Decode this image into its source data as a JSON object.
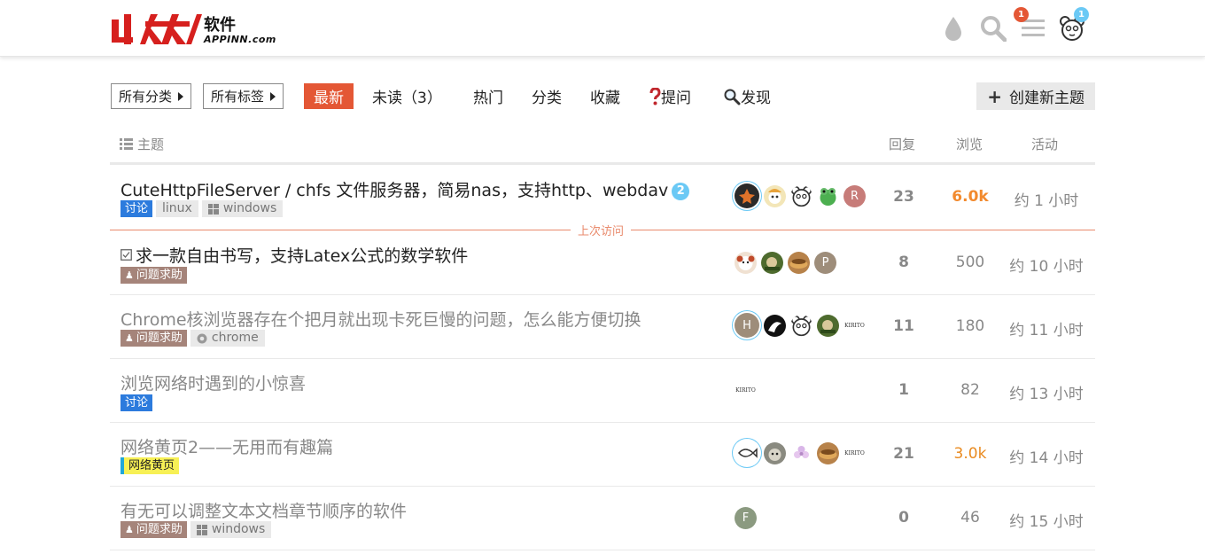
{
  "header": {
    "logo_cn": "软件",
    "logo_en": "APPINN.com",
    "icons": [
      "drop-icon",
      "search-icon",
      "hamburger-icon",
      "user-avatar-icon"
    ],
    "menu_badge": "1",
    "user_badge": "1",
    "colors": {
      "accent": "#e45735",
      "badge_blue": "#6bc9f5"
    }
  },
  "nav": {
    "categories_dropdown": "所有分类",
    "tags_dropdown": "所有标签",
    "items": [
      "最新",
      "未读（3）",
      "热门",
      "分类",
      "收藏",
      "提问",
      "发现"
    ],
    "active": "最新",
    "create_button": "创建新主题"
  },
  "table": {
    "headers": {
      "topic": "主题",
      "replies": "回复",
      "views": "浏览",
      "activity": "活动"
    },
    "last_visit_label": "上次访问",
    "topics": [
      {
        "title": "CuteHttpFileServer / chfs 文件服务器，简易nas，支持http、webdav",
        "unread": "2",
        "category": "讨论",
        "tags": [
          "linux",
          "windows"
        ],
        "replies": "23",
        "views": "6.0k",
        "activity": "约 1 小时"
      },
      {
        "title": "求一款自由书写，支持Latex公式的数学软件",
        "category": "问题求助",
        "tags": [],
        "replies": "8",
        "views": "500",
        "activity": "约 10 小时"
      },
      {
        "title": "Chrome核浏览器存在个把月就出现卡死巨慢的问题，怎么能方便切换",
        "category": "问题求助",
        "tags": [
          "chrome"
        ],
        "replies": "11",
        "views": "180",
        "activity": "约 11 小时"
      },
      {
        "title": "浏览网络时遇到的小惊喜",
        "category": "讨论",
        "tags": [],
        "replies": "1",
        "views": "82",
        "activity": "约 13 小时"
      },
      {
        "title": "网络黄页2——无用而有趣篇",
        "category": "网络黄页",
        "tags": [],
        "replies": "21",
        "views": "3.0k",
        "activity": "约 14 小时"
      },
      {
        "title": "有无可以调整文本文档章节顺序的软件",
        "category": "问题求助",
        "tags": [
          "windows"
        ],
        "replies": "0",
        "views": "46",
        "activity": "约 15 小时"
      }
    ]
  },
  "posters": {
    "r0_p4": "R",
    "r1_p3": "P",
    "r2_p0": "H",
    "r5_p0": "F",
    "kirito": "KIRITO"
  }
}
